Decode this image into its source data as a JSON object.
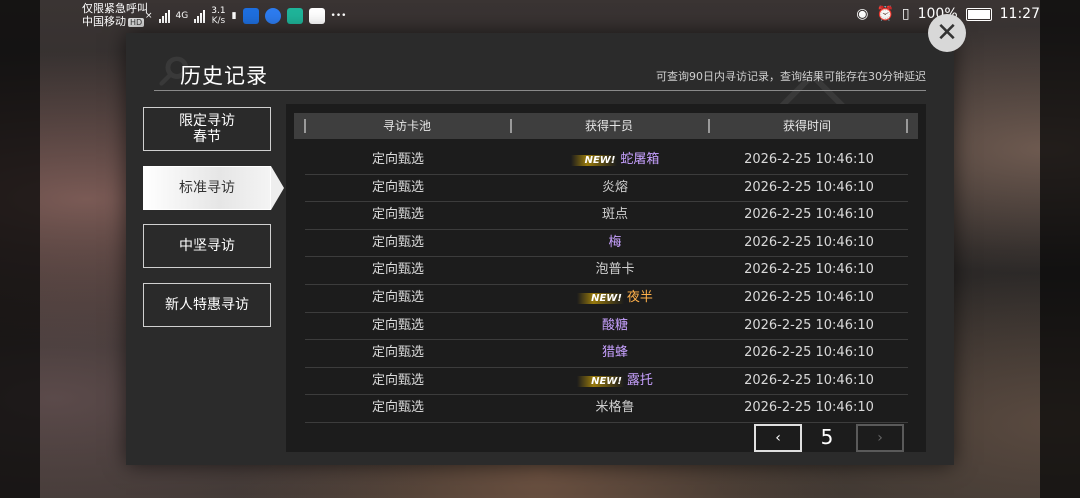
{
  "status_bar": {
    "emergency_text": "仅限紧急呼叫",
    "carrier": "中国移动",
    "hd_badge": "HD",
    "network": "4G",
    "speed_value": "3.1",
    "speed_unit": "K/s",
    "battery": "100%",
    "time": "11:27"
  },
  "dialog": {
    "title": "历史记录",
    "notice": "可查询90日内寻访记录，查询结果可能存在30分钟延迟",
    "close_symbol": "✕"
  },
  "menu": [
    {
      "label_line1": "限定寻访",
      "label_line2": "春节",
      "active": false
    },
    {
      "label_line1": "标准寻访",
      "label_line2": "",
      "active": true
    },
    {
      "label_line1": "中坚寻访",
      "label_line2": "",
      "active": false
    },
    {
      "label_line1": "新人特惠寻访",
      "label_line2": "",
      "active": false
    }
  ],
  "table": {
    "headers": [
      "寻访卡池",
      "获得干员",
      "获得时间"
    ],
    "new_badge": "NEW!",
    "rows": [
      {
        "pool": "定向甄选",
        "operator": "蛇屠箱",
        "is_new": true,
        "rarity": 4,
        "time": "2026-2-25 10:46:10"
      },
      {
        "pool": "定向甄选",
        "operator": "炎熔",
        "is_new": false,
        "rarity": 3,
        "time": "2026-2-25 10:46:10"
      },
      {
        "pool": "定向甄选",
        "operator": "斑点",
        "is_new": false,
        "rarity": 3,
        "time": "2026-2-25 10:46:10"
      },
      {
        "pool": "定向甄选",
        "operator": "梅",
        "is_new": false,
        "rarity": 4,
        "time": "2026-2-25 10:46:10"
      },
      {
        "pool": "定向甄选",
        "operator": "泡普卡",
        "is_new": false,
        "rarity": 3,
        "time": "2026-2-25 10:46:10"
      },
      {
        "pool": "定向甄选",
        "operator": "夜半",
        "is_new": true,
        "rarity": 5,
        "time": "2026-2-25 10:46:10"
      },
      {
        "pool": "定向甄选",
        "operator": "酸糖",
        "is_new": false,
        "rarity": 4,
        "time": "2026-2-25 10:46:10"
      },
      {
        "pool": "定向甄选",
        "operator": "猎蜂",
        "is_new": false,
        "rarity": 4,
        "time": "2026-2-25 10:46:10"
      },
      {
        "pool": "定向甄选",
        "operator": "露托",
        "is_new": true,
        "rarity": 4,
        "time": "2026-2-25 10:46:10"
      },
      {
        "pool": "定向甄选",
        "operator": "米格鲁",
        "is_new": false,
        "rarity": 3,
        "time": "2026-2-25 10:46:10"
      }
    ]
  },
  "pager": {
    "page": "5",
    "prev_symbol": "‹",
    "next_symbol": "›"
  },
  "colors": {
    "rarity_3": "#cfcfcf",
    "rarity_4": "#c7a1ff",
    "rarity_5": "#ffb04a"
  }
}
